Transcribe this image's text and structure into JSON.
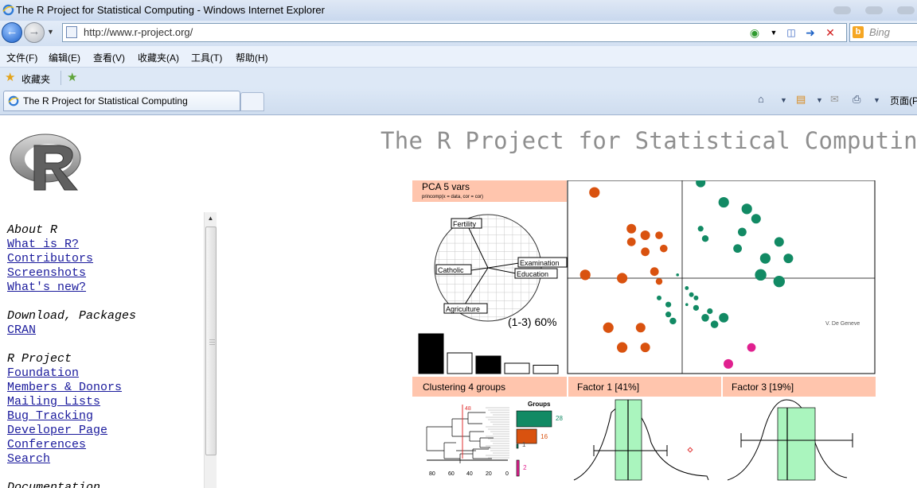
{
  "window": {
    "title": "The R Project for Statistical Computing - Windows Internet Explorer"
  },
  "addressbar": {
    "url": "http://www.r-project.org/",
    "search_placeholder": "Bing"
  },
  "menubar": {
    "items": [
      "文件(F)",
      "编辑(E)",
      "查看(V)",
      "收藏夹(A)",
      "工具(T)",
      "帮助(H)"
    ]
  },
  "favorites": {
    "label": "收藏夹"
  },
  "tab": {
    "title": "The R Project for Statistical Computing"
  },
  "commandbar": {
    "page_label": "页面(P"
  },
  "page": {
    "title": "The R Project for Statistical Computing",
    "nav": {
      "about": {
        "heading": "About R",
        "links": [
          "What is R?",
          "Contributors",
          "Screenshots",
          "What's new?"
        ]
      },
      "download": {
        "heading": "Download, Packages",
        "links": [
          "CRAN"
        ]
      },
      "project": {
        "heading": "R Project",
        "links": [
          "Foundation",
          "Members & Donors",
          "Mailing Lists",
          "Bug Tracking",
          "Developer Page",
          "Conferences",
          "Search"
        ]
      },
      "more_heading": "Documentation"
    }
  },
  "figure": {
    "colors": {
      "header_bg": "#ffc5ad",
      "orange": "#d9520f",
      "green": "#128a64",
      "magenta": "#e0208f",
      "hist_fill": "#aaf5be"
    },
    "pca": {
      "title": "PCA  5 vars",
      "subtitle": "princomp(x = data, cor = cor)",
      "variables": [
        "Fertility",
        "Examination",
        "Education",
        "Catholic",
        "Agriculture"
      ],
      "explained": "(1-3) 60%",
      "scree_values": [
        1.0,
        0.52,
        0.44,
        0.26,
        0.21
      ]
    },
    "scatter": {
      "credit": "V. De Geneve",
      "orange_points": [
        [
          -1.9,
          2.6,
          1.1
        ],
        [
          -1.1,
          1.5,
          1.0
        ],
        [
          -0.8,
          1.3,
          1.0
        ],
        [
          -0.5,
          1.3,
          0.8
        ],
        [
          -0.4,
          0.9,
          0.8
        ],
        [
          -1.1,
          1.1,
          0.9
        ],
        [
          -0.8,
          0.8,
          0.9
        ],
        [
          -2.1,
          0.1,
          1.1
        ],
        [
          -1.3,
          0.0,
          1.1
        ],
        [
          -0.6,
          0.2,
          0.9
        ],
        [
          -0.5,
          -0.1,
          0.7
        ],
        [
          -1.6,
          -1.5,
          1.1
        ],
        [
          -0.9,
          -1.5,
          1.0
        ],
        [
          -1.3,
          -2.1,
          1.1
        ],
        [
          -0.8,
          -2.1,
          1.0
        ]
      ],
      "green_points": [
        [
          0.4,
          2.9,
          1.0
        ],
        [
          0.9,
          2.3,
          1.1
        ],
        [
          1.4,
          2.1,
          1.1
        ],
        [
          1.6,
          1.8,
          1.0
        ],
        [
          1.3,
          1.4,
          0.9
        ],
        [
          0.4,
          1.5,
          0.6
        ],
        [
          0.5,
          1.2,
          0.7
        ],
        [
          1.2,
          0.9,
          0.9
        ],
        [
          2.1,
          1.1,
          1.0
        ],
        [
          1.8,
          0.6,
          1.1
        ],
        [
          2.3,
          0.6,
          1.0
        ],
        [
          1.7,
          0.1,
          1.2
        ],
        [
          2.1,
          -0.1,
          1.2
        ],
        [
          -0.1,
          0.1,
          0.3
        ],
        [
          0.1,
          -0.3,
          0.4
        ],
        [
          0.2,
          -0.5,
          0.5
        ],
        [
          0.3,
          -0.6,
          0.5
        ],
        [
          0.3,
          -0.9,
          0.6
        ],
        [
          0.6,
          -1.0,
          0.6
        ],
        [
          0.5,
          -1.2,
          0.8
        ],
        [
          0.7,
          -1.4,
          0.8
        ],
        [
          0.9,
          -1.2,
          1.0
        ],
        [
          -0.5,
          -0.6,
          0.5
        ],
        [
          -0.3,
          -0.8,
          0.6
        ],
        [
          -0.3,
          -1.1,
          0.6
        ],
        [
          -0.2,
          -1.3,
          0.7
        ],
        [
          0.1,
          -0.8,
          0.3
        ]
      ],
      "magenta_points": [
        [
          1.5,
          -2.1,
          0.9
        ],
        [
          1.0,
          -2.6,
          1.0
        ]
      ]
    },
    "clustering": {
      "title": "Clustering  4 groups",
      "cut_label": "48",
      "groups_label": "Groups",
      "groups": [
        {
          "n": 28,
          "color": "#128a64"
        },
        {
          "n": 16,
          "color": "#d9520f"
        },
        {
          "n": 1,
          "color": "#128a64"
        },
        {
          "n": 2,
          "color": "#e0208f"
        }
      ],
      "axis_ticks": [
        "80",
        "60",
        "40",
        "20",
        "0"
      ]
    },
    "factor1": {
      "title": "Factor 1 [41%]"
    },
    "factor3": {
      "title": "Factor 3 [19%]"
    }
  }
}
